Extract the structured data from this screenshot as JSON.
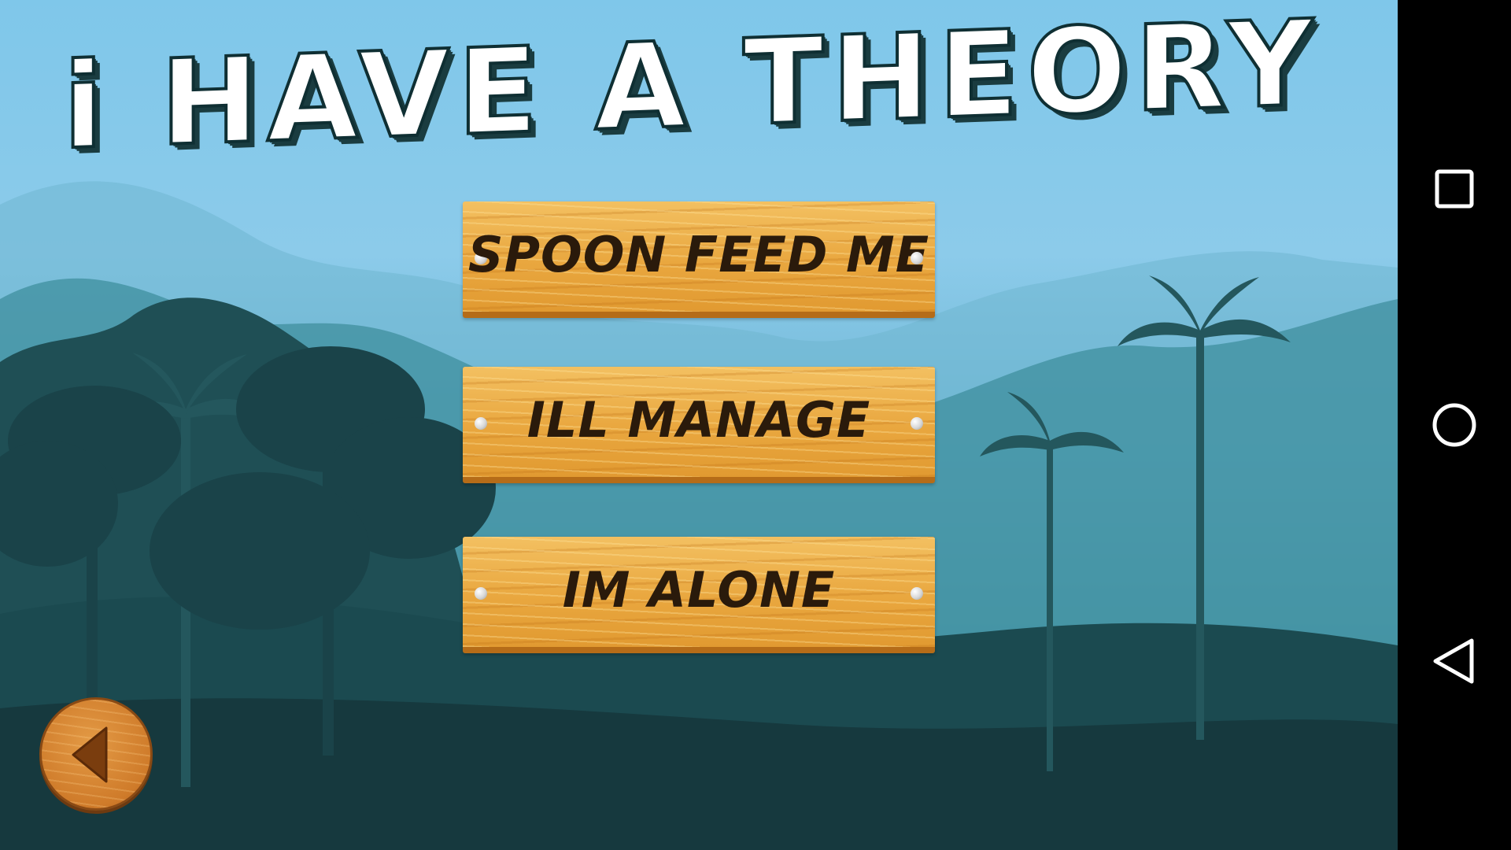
{
  "game": {
    "title": "i HAVE A THEORY",
    "menu": [
      {
        "label": "SPOON FEED ME"
      },
      {
        "label": "ILL MANAGE"
      },
      {
        "label": "IM ALONE"
      }
    ],
    "back_button_icon": "back-arrow-icon"
  },
  "navbar": {
    "icons": [
      "recent-apps-icon",
      "home-icon",
      "back-icon"
    ]
  },
  "colors": {
    "sky": "#7fc7ea",
    "plank": "#e9a73f",
    "plank_text": "#2a1a0b",
    "title_outline": "#0f2f33"
  }
}
